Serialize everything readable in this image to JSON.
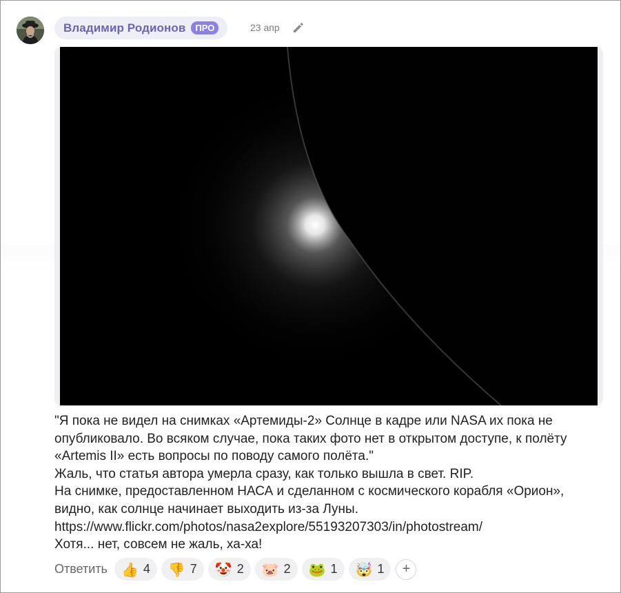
{
  "author": {
    "name": "Владимир Родионов",
    "badge": "ПРО",
    "date": "23 апр"
  },
  "icons": {
    "avatar": "user-avatar-photo",
    "edit": "pencil-icon",
    "add_reaction": "plus-icon"
  },
  "post": {
    "lines": [
      "\"Я пока не видел на снимках «Артемиды-2» Солнце в кадре или NASA их пока не",
      "опубликовало. Во всяком случае, пока таких фото нет в открытом доступе, к полёту",
      "«Artemis II» есть вопросы по поводу самого полёта.\"",
      "Жаль, что статья автора умерла сразу, как только вышла в свет. RIP.",
      "На снимке, предоставленном НАСА и сделанном с космического корабля «Орион»,",
      "видно, как солнце начинает выходить из-за Луны.",
      "https://www.flickr.com/photos/nasa2explore/55193207303/in/photostream/",
      "Хотя... нет, совсем не жаль, ха-ха!"
    ]
  },
  "actions": {
    "reply_label": "Ответить",
    "add_symbol": "+",
    "reactions": [
      {
        "emoji": "👍",
        "name": "thumbs-up",
        "count": "4"
      },
      {
        "emoji": "👎",
        "name": "thumbs-down",
        "count": "7"
      },
      {
        "emoji": "🤡",
        "name": "clown",
        "count": "2"
      },
      {
        "emoji": "🐷",
        "name": "pig",
        "count": "2"
      },
      {
        "emoji": "🐸",
        "name": "frog",
        "count": "1"
      },
      {
        "emoji": "🤯",
        "name": "exploding-head",
        "count": "1"
      }
    ]
  },
  "colors": {
    "author_chip_bg": "#eeeef7",
    "author_name": "#6a64b7",
    "pro_badge": "#8c7fe6",
    "reaction_bg": "#f0f0f3"
  }
}
